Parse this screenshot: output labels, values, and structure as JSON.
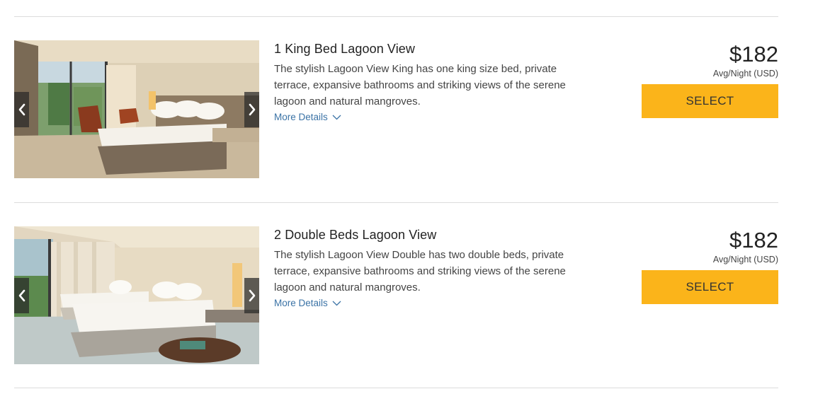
{
  "rooms": [
    {
      "title": "1 King Bed Lagoon View",
      "description": "The stylish Lagoon View King has one king size bed, private terrace, expansive bathrooms and striking views of the serene lagoon and natural mangroves.",
      "more_details": "More Details",
      "price": "$182",
      "price_note": "Avg/Night (USD)",
      "select_label": "SELECT"
    },
    {
      "title": "2 Double Beds Lagoon View",
      "description": "The stylish Lagoon View Double has two double beds, private terrace, expansive bathrooms and striking views of the serene lagoon and natural mangroves.",
      "more_details": "More Details",
      "price": "$182",
      "price_note": "Avg/Night (USD)",
      "select_label": "SELECT"
    }
  ],
  "colors": {
    "accent": "#fbb41a",
    "link": "#3b73a6",
    "divider": "#dcdcdc"
  },
  "icons": {
    "prev": "chevron-left-icon",
    "next": "chevron-right-icon",
    "expand": "chevron-down-icon"
  }
}
